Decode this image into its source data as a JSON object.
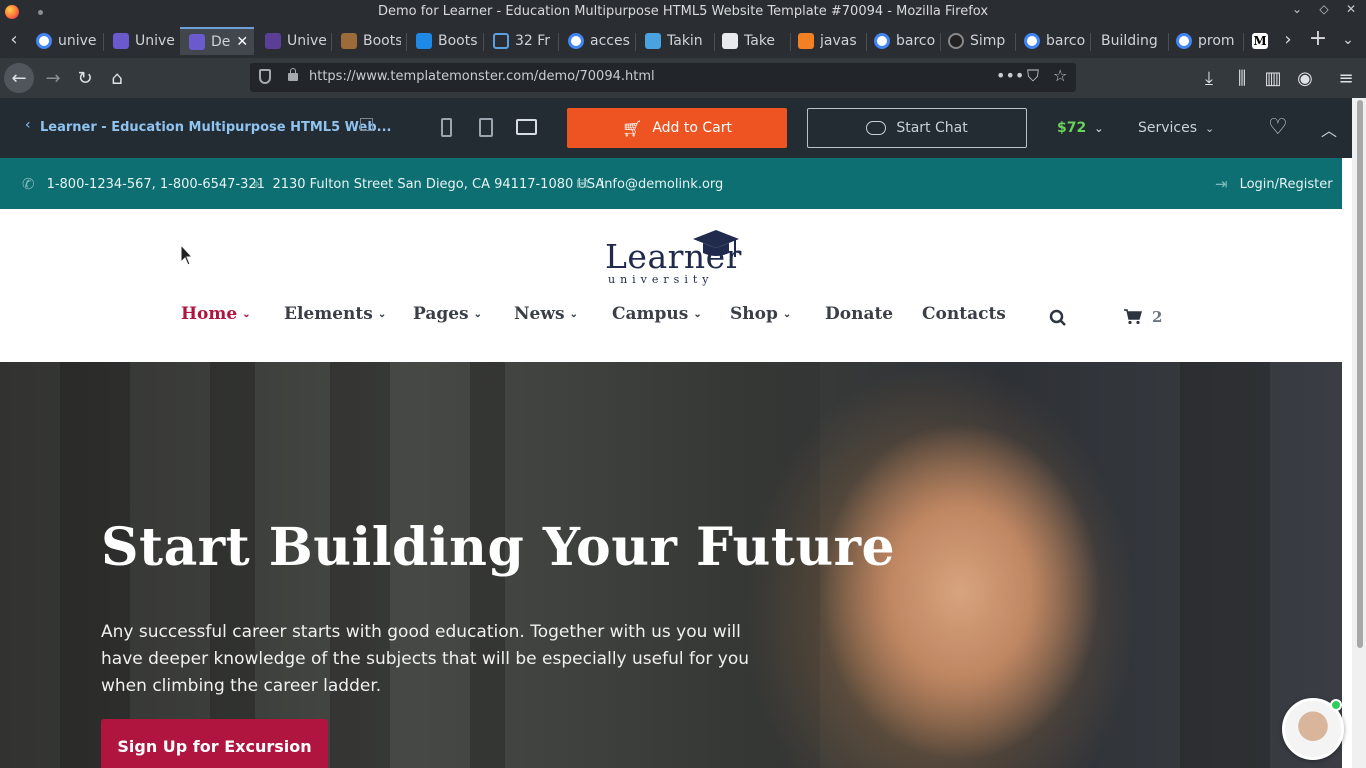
{
  "window": {
    "title": "Demo for Learner - Education Multipurpose HTML5 Website Template #70094 - Mozilla Firefox"
  },
  "tabs": [
    {
      "label": "unive",
      "favicon": "google-icon"
    },
    {
      "label": "Unive",
      "favicon": "template-icon"
    },
    {
      "label": "De",
      "favicon": "template-icon",
      "active": true
    },
    {
      "label": "Unive",
      "favicon": "colorlib-icon"
    },
    {
      "label": "Boots",
      "favicon": "bootstrap-icon"
    },
    {
      "label": "Boots",
      "favicon": "bootstrap-icon"
    },
    {
      "label": "32 Fr",
      "favicon": "bookmark-icon"
    },
    {
      "label": "acces",
      "favicon": "google-icon"
    },
    {
      "label": "Takin",
      "favicon": "site-icon"
    },
    {
      "label": "Take",
      "favicon": "code-icon"
    },
    {
      "label": "javas",
      "favicon": "stackoverflow-icon"
    },
    {
      "label": "barco",
      "favicon": "google-icon"
    },
    {
      "label": "Simp",
      "favicon": "site-icon"
    },
    {
      "label": "barco",
      "favicon": "google-icon"
    },
    {
      "label": "Building",
      "favicon": "none"
    },
    {
      "label": "prom",
      "favicon": "google-icon"
    },
    {
      "label": "",
      "favicon": "medium-icon"
    }
  ],
  "toolbar": {
    "url": "https://www.templatemonster.com/demo/70094.html"
  },
  "tm_bar": {
    "title": "Learner - Education Multipurpose HTML5 Web...",
    "add_to_cart": "Add to Cart",
    "start_chat": "Start Chat",
    "price": "$72",
    "services": "Services"
  },
  "info_bar": {
    "phone": "1-800-1234-567, 1-800-6547-321",
    "address": "2130 Fulton Street San Diego, CA 94117-1080 USA",
    "email": "info@demolink.org",
    "login": "Login/Register"
  },
  "logo": {
    "word": "Learner",
    "sub": "university"
  },
  "nav": {
    "items": [
      "Home",
      "Elements",
      "Pages",
      "News",
      "Campus",
      "Shop",
      "Donate",
      "Contacts"
    ],
    "cart_count": "2"
  },
  "hero": {
    "heading": "Start Building Your Future",
    "text": "Any successful career starts with good education. Together with us you will have deeper knowledge of the subjects that will be especially useful for you when climbing the career ladder.",
    "cta": "Sign Up for Excursion"
  },
  "colors": {
    "teal": "#0d6f72",
    "brand_red": "#b0153f",
    "orange": "#ed5422",
    "navy": "#1f2a4d"
  }
}
